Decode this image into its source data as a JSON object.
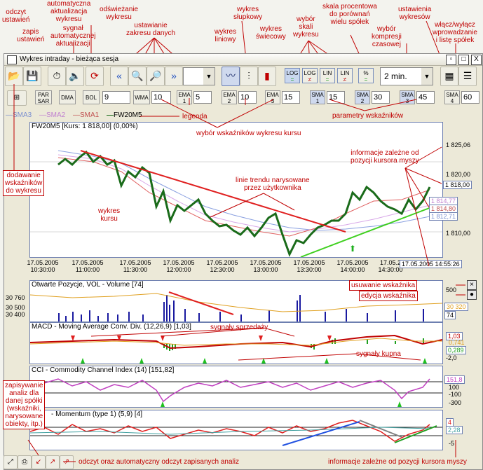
{
  "annotations": {
    "odczyt": "odczyt\nustawień",
    "zapis": "zapis\nustawień",
    "auto": "automatyczna\naktualizacja\nwykresu",
    "sygnal": "sygnał\nautomatycznej\naktualizacji",
    "odswiez": "odświeżanie\nwykresu",
    "zakres": "ustawianie\nzakresu danych",
    "liniowy": "wykres\nliniowy",
    "slupkowy": "wykres\nsłupkowy",
    "swiecowy": "wykres\nświecowy",
    "skala": "wybór\nskali\nwykresu",
    "procentowa": "skala procentowa\ndo porównań\nwielu spółek",
    "kompresja": "wybór\nkompresji\nczasowej",
    "ustawienia": "ustawienia\nwykresów",
    "wlacz": "włącz/wyłącz\nwprowadzanie\ni listę spółek",
    "legenda": "legenda",
    "wybor_wsk": "wybór wskaźników wykresu kursu",
    "parametry": "parametry wskaźników",
    "dodawanie": "dodawanie\nwskaźników\ndo wykresu",
    "kurs": "wykres\nkursu",
    "trend": "linie trendu narysowane\nprzez użytkownika",
    "info_kursor": "informacje zależne od\npozycji kursora myszy",
    "usuwanie": "usuwanie wskaźnika",
    "edycja": "edycja wskaźnika",
    "sprzedazy": "sygnały sprzedaży",
    "kupna": "sygnały kupna",
    "zapisywanie": "zapisywanie\nanaliz dla\ndanej spółki\n(wskaźniki,\nnarysowane\nobiekty, itp.)",
    "odczyt_analiz": "odczyt oraz automatyczny odczyt zapisanych analiz",
    "info_bottom": "informacje zależne od pozycji kursora myszy"
  },
  "window": {
    "title": "Wykres intraday - bieżąca sesja",
    "close": "X"
  },
  "toolbar": {
    "scale_buttons": [
      {
        "top": "LOG",
        "bottom": "="
      },
      {
        "top": "LOG",
        "bottom": "≠"
      },
      {
        "top": "LIN",
        "bottom": "="
      },
      {
        "top": "LIN",
        "bottom": "≠"
      },
      {
        "top": "%",
        "bottom": "="
      }
    ],
    "compression": "2 min."
  },
  "indicators": {
    "sar": "PAR\nSAR",
    "dma": "DMA",
    "bol": "BOL",
    "bol_val": "9",
    "wma": "WMA",
    "wma_val": "10",
    "ema": [
      {
        "label": "EMA\n1",
        "val": "5"
      },
      {
        "label": "EMA\n2",
        "val": "10"
      },
      {
        "label": "EMA\n3",
        "val": "15"
      }
    ],
    "sma": [
      {
        "label": "SMA\n1",
        "val": "15"
      },
      {
        "label": "SMA\n2",
        "val": "30"
      },
      {
        "label": "SMA\n3",
        "val": "45"
      },
      {
        "label": "SMA\n4",
        "val": "60"
      }
    ]
  },
  "legend": [
    "SMA3",
    "SMA2",
    "SMA1",
    "FW20M5"
  ],
  "colors": {
    "sma3": "#7a8fd0",
    "sma2": "#d4a0e0",
    "sma1": "#e05050",
    "price": "#1a6b1a",
    "annot": "#c00000"
  },
  "price_panel": {
    "title": "FW20M5 [Kurs: 1 818,00] (0,00%)",
    "yticks": [
      "1 825,06",
      "1 820,00",
      "1 818,00",
      "1 814,77",
      "1 814,80",
      "1 812,71",
      "1 810,00"
    ],
    "xticks": [
      {
        "d": "17.05.2005",
        "t": "10:30:00"
      },
      {
        "d": "17.05.2005",
        "t": "11:00:00"
      },
      {
        "d": "17.05.2005",
        "t": "11:30:00"
      },
      {
        "d": "17.05.2005",
        "t": "12:00:00"
      },
      {
        "d": "17.05.2005",
        "t": "12:30:00"
      },
      {
        "d": "17.05.2005",
        "t": "13:00:00"
      },
      {
        "d": "17.05.2005",
        "t": "13:30:00"
      },
      {
        "d": "17.05.2005",
        "t": "14:00:00"
      },
      {
        "d": "17.05.2",
        "t": "14:30:00"
      }
    ],
    "cursor_time": "17.05.2005 14:55:26"
  },
  "volume_panel": {
    "title": "Otwarte Pozycje, VOL - Volume [74]",
    "yleft": [
      "30 760",
      "30 500",
      "30 400"
    ],
    "yright": [
      "500",
      "30 320",
      "74"
    ]
  },
  "macd_panel": {
    "title": "MACD - Moving Average Conv. Div. (12,26,9) [1,03]",
    "yright": [
      "1,03",
      "0,741",
      "0,289",
      "-2,0"
    ]
  },
  "cci_panel": {
    "title": "CCI - Commodity Channel Index (14) [151,82]",
    "yright": [
      "151,8",
      "100",
      "-100",
      "-300"
    ]
  },
  "mom_panel": {
    "title": "- Momentum (type 1) (5,9) [4]",
    "yright": [
      "4",
      "2,28",
      "-5"
    ]
  }
}
